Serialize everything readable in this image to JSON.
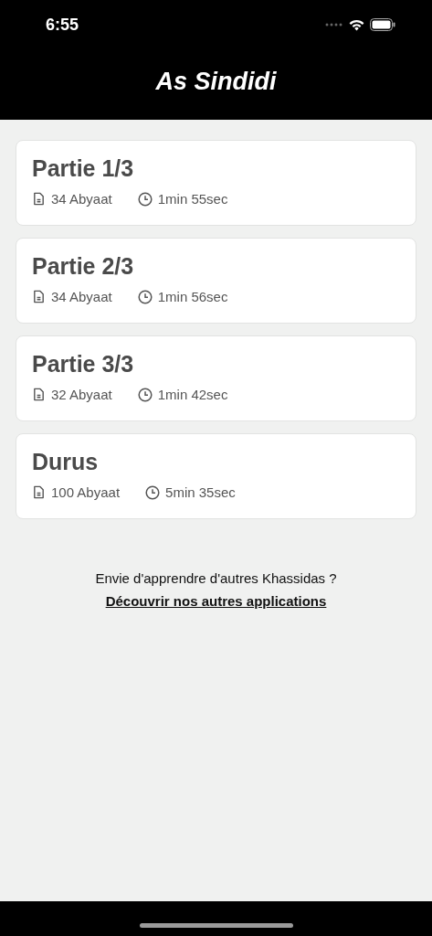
{
  "status_bar": {
    "time": "6:55"
  },
  "header": {
    "title": "As Sindidi"
  },
  "parts": [
    {
      "title": "Partie 1/3",
      "verses": "34 Abyaat",
      "duration": "1min 55sec"
    },
    {
      "title": "Partie 2/3",
      "verses": "34 Abyaat",
      "duration": "1min 56sec"
    },
    {
      "title": "Partie 3/3",
      "verses": "32 Abyaat",
      "duration": "1min 42sec"
    },
    {
      "title": "Durus",
      "verses": "100 Abyaat",
      "duration": "5min 35sec"
    }
  ],
  "footer": {
    "prompt": "Envie d'apprendre d'autres Khassidas ?",
    "link": "Découvrir nos autres applications"
  }
}
